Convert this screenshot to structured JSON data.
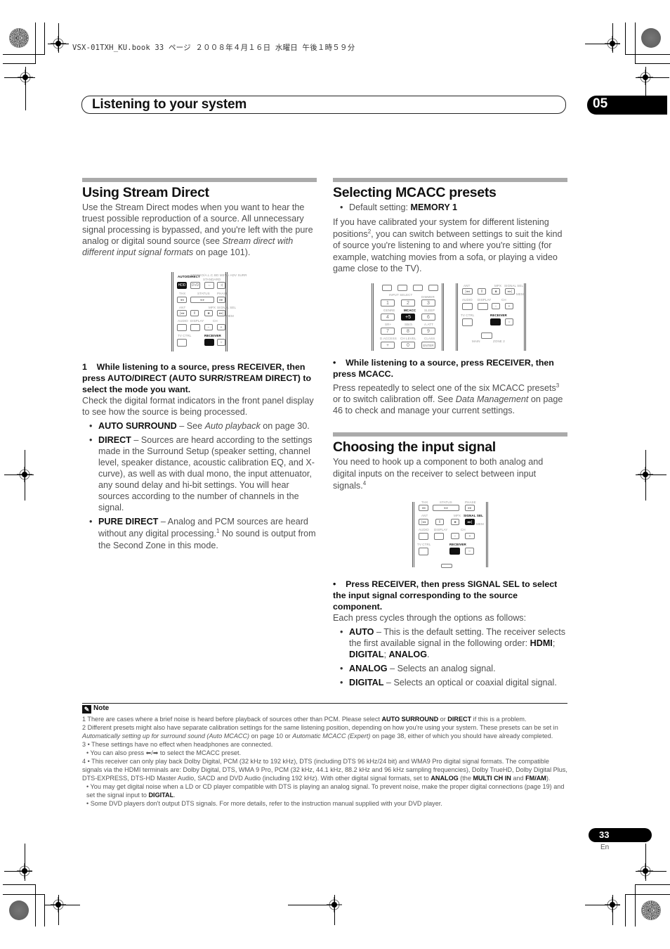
{
  "slug": "VSX-01TXH_KU.book  33 ページ  ２００８年４月１６日  水曜日  午後１時５９分",
  "header": {
    "chapter_title": "Listening to your system",
    "chapter_number": "05"
  },
  "sections": {
    "stream_direct": {
      "title": "Using Stream Direct",
      "intro": "Use the Stream Direct modes when you want to hear the truest possible reproduction of a source. All unnecessary signal processing is bypassed, and you're left with the pure analog or digital sound source (see ",
      "intro_link": "Stream direct with different input signal formats",
      "intro_tail": " on page 101).",
      "step": "1    While listening to a source, press RECEIVER, then press AUTO/DIRECT (AUTO SURR/STREAM DIRECT) to select the mode you want.",
      "step_desc": "Check the digital format indicators in the front panel display to see how the source is being processed.",
      "bullets": [
        {
          "term": "AUTO SURROUND",
          "text_pre": " – See ",
          "italic": "Auto playback",
          "text_post": " on page 30."
        },
        {
          "term": "DIRECT",
          "text_pre": " – Sources are heard according to the settings made in the Surround Setup (speaker setting, channel level, speaker distance, acoustic calibration EQ, and X-curve), as well as with dual mono, the input attenuator, any sound delay and hi-bit settings. You will hear sources according to the number of channels in the signal.",
          "italic": "",
          "text_post": ""
        },
        {
          "term": "PURE DIRECT",
          "text_pre": " – Analog and PCM sources are heard without any digital processing.",
          "sup": "1",
          "text_post": " No sound is output from the Second Zone in this mode."
        }
      ],
      "remote": {
        "labels": [
          "AUTO/DIRECT",
          "STEREO/A.L.C.",
          "STANDARD",
          "BD MENU ADV SURR",
          "THX",
          "STATUS",
          "PHASE",
          "ANT",
          "MPX",
          "SIGNAL SEL",
          "MEM",
          "AUDIO",
          "DISPLAY",
          "CH",
          "TV CTRL",
          "RECEIVER"
        ],
        "buttons": [
          "HDD",
          "DVD",
          "⇔",
          "⤨",
          "◂◂",
          "◂ ▸",
          "▸▸",
          "|◂◂",
          "II",
          "■",
          "▸▸|",
          "",
          "",
          "−",
          "+",
          "",
          "",
          "☼"
        ]
      }
    },
    "mcacc": {
      "title": "Selecting MCACC presets",
      "default_label": "Default setting: ",
      "default_value": "MEMORY 1",
      "intro_pre": "If you have calibrated your system for different listening positions",
      "intro_sup": "2",
      "intro_post": ", you can switch between settings to suit the kind of source you're listening to and where you're sitting (for example, watching movies from a sofa, or playing a video game close to the TV).",
      "step": "•    While listening to a source, press RECEIVER, then press MCACC.",
      "desc_pre": "Press repeatedly to select one of the six MCACC presets",
      "desc_sup": "3",
      "desc_mid": " or to switch calibration off. See ",
      "desc_italic": "Data Management",
      "desc_post": " on page 46 to check and manage your current settings.",
      "remote_left": {
        "labels": [
          "INPUT SELECT",
          "DIMMER",
          "GENRE",
          "MCACC",
          "SLEEP",
          "SR+",
          "SBch",
          "A.ATT",
          "D.ACCESS",
          "CH LEVEL",
          "CLASS"
        ],
        "buttons": [
          "1",
          "2",
          "3",
          "4",
          "+5",
          "6",
          "7",
          "8",
          "9",
          "+",
          "0",
          "ENTER"
        ]
      },
      "remote_right": {
        "labels": [
          "ANT",
          "MPX",
          "SIGNAL SEL",
          "MEM",
          "AUDIO",
          "DISPLAY",
          "CH",
          "TV CTRL",
          "RECEIVER",
          "MAIN",
          "ZONE 2"
        ],
        "buttons": [
          "|◂◂",
          "II",
          "■",
          "▸▸|",
          "",
          "",
          "−",
          "+",
          "",
          "",
          "☼"
        ]
      }
    },
    "input_signal": {
      "title": "Choosing the input signal",
      "intro_pre": "You need to hook up a component to both analog and digital inputs on the receiver to select between input signals.",
      "intro_sup": "4",
      "step": "•    Press RECEIVER, then press SIGNAL SEL to select the input signal corresponding to the source component.",
      "step_desc": "Each press cycles through the options as follows:",
      "bullets": [
        {
          "term": "AUTO",
          "text": " – This is the default setting. The receiver selects the first available signal in the following order: ",
          "order": [
            "HDMI",
            "DIGITAL",
            "ANALOG"
          ]
        },
        {
          "term": "ANALOG",
          "text": " – Selects an analog signal."
        },
        {
          "term": "DIGITAL",
          "text": " – Selects an optical or coaxial digital signal."
        }
      ],
      "remote": {
        "labels": [
          "THX",
          "STATUS",
          "PHASE",
          "ANT",
          "MPX",
          "SIGNAL SEL",
          "MEM",
          "AUDIO",
          "DISPLAY",
          "CH",
          "TV CTRL",
          "RECEIVER"
        ],
        "buttons": [
          "◂◂",
          "◂ ▸",
          "▸▸",
          "|◂◂",
          "II",
          "■",
          "▸▸|",
          "",
          "",
          "−",
          "+",
          "",
          "",
          "☼"
        ]
      }
    }
  },
  "notes": {
    "heading": "Note",
    "items": [
      {
        "num": "1",
        "parts": [
          [
            "t",
            "There are cases where a brief noise is heard before playback of sources other than PCM. Please select "
          ],
          [
            "b",
            "AUTO SURROUND"
          ],
          [
            "t",
            " or "
          ],
          [
            "b",
            "DIRECT"
          ],
          [
            "t",
            " if this is a problem."
          ]
        ]
      },
      {
        "num": "2",
        "parts": [
          [
            "t",
            "Different presets might also have separate calibration settings for the same listening position, depending on how you're using your system. These presets can be set in "
          ],
          [
            "i",
            "Automatically setting up for surround sound (Auto MCACC)"
          ],
          [
            "t",
            " on page 10 or "
          ],
          [
            "i",
            "Automatic MCACC (Expert)"
          ],
          [
            "t",
            " on page 38, either of which you should have already completed."
          ]
        ]
      },
      {
        "num": "3",
        "parts": [
          [
            "t",
            "• These settings have no effect when headphones are connected."
          ]
        ]
      },
      {
        "num": "",
        "parts": [
          [
            "t",
            "• You can also press ⬅/➡ to select the MCACC preset."
          ]
        ]
      },
      {
        "num": "4",
        "parts": [
          [
            "t",
            "• This receiver can only play back Dolby Digital, PCM (32 kHz to 192 kHz), DTS (including DTS 96 kHz/24 bit) and WMA9 Pro digital signal formats. The compatible signals via the HDMI terminals are: Dolby Digital, DTS, WMA 9 Pro, PCM (32 kHz, 44.1 kHz, 88.2 kHz and 96 kHz sampling frequencies), Dolby TrueHD, Dolby Digital Plus, DTS-EXPRESS, DTS-HD Master Audio, SACD and DVD Audio (including 192 kHz). With other digital signal formats, set to "
          ],
          [
            "b",
            "ANALOG"
          ],
          [
            "t",
            " (the "
          ],
          [
            "b",
            "MULTI CH IN"
          ],
          [
            "t",
            " and "
          ],
          [
            "b",
            "FM/AM"
          ],
          [
            "t",
            ")."
          ]
        ]
      },
      {
        "num": "",
        "parts": [
          [
            "t",
            "• You may get digital noise when a LD or CD player compatible with DTS is playing an analog signal. To prevent noise, make the proper digital connections (page 19) and set the signal input to "
          ],
          [
            "b",
            "DIGITAL"
          ],
          [
            "t",
            "."
          ]
        ]
      },
      {
        "num": "",
        "parts": [
          [
            "t",
            "• Some DVD players don't output DTS signals. For more details, refer to the instruction manual supplied with your DVD player."
          ]
        ]
      }
    ]
  },
  "footer": {
    "page_number": "33",
    "language": "En"
  }
}
